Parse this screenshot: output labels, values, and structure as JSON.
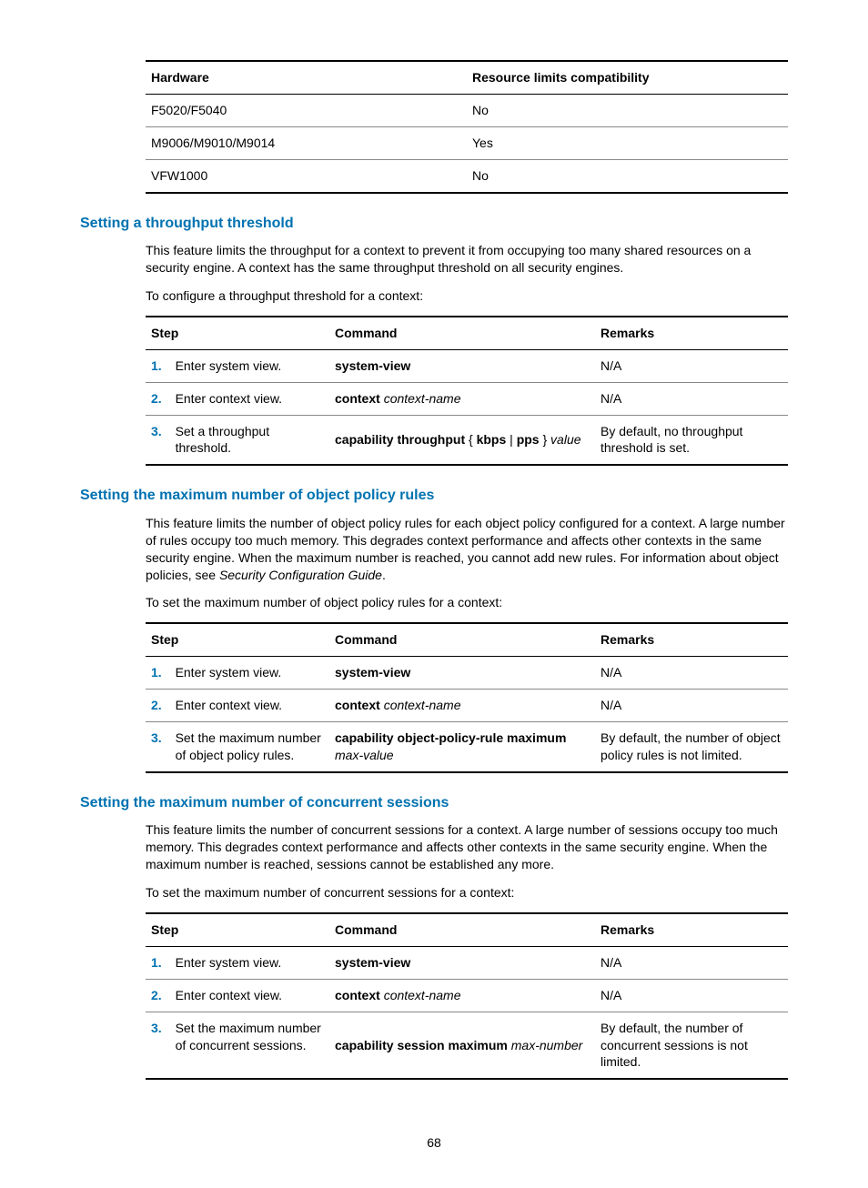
{
  "hwTable": {
    "headers": [
      "Hardware",
      "Resource limits compatibility"
    ],
    "rows": [
      [
        "F5020/F5040",
        "No"
      ],
      [
        "M9006/M9010/M9014",
        "Yes"
      ],
      [
        "VFW1000",
        "No"
      ]
    ]
  },
  "sections": [
    {
      "heading": "Setting a throughput threshold",
      "paras": [
        "This feature limits the throughput for a context to prevent it from occupying too many shared resources on a security engine. A context has the same throughput threshold on all security engines.",
        "To configure a throughput threshold for a context:"
      ],
      "table": {
        "headers": [
          "Step",
          "Command",
          "Remarks"
        ],
        "rows": [
          {
            "num": "1.",
            "desc": "Enter system view.",
            "cmd_parts": [
              {
                "b": "system-view"
              }
            ],
            "remarks": "N/A"
          },
          {
            "num": "2.",
            "desc": "Enter context view.",
            "cmd_parts": [
              {
                "b": "context "
              },
              {
                "i": "context-name"
              }
            ],
            "remarks": "N/A"
          },
          {
            "num": "3.",
            "desc": "Set a throughput threshold.",
            "cmd_parts": [
              {
                "b": "capability throughput"
              },
              {
                "t": " { "
              },
              {
                "b": "kbps"
              },
              {
                "t": " | "
              },
              {
                "b": "pps"
              },
              {
                "t": " } "
              },
              {
                "i": "value"
              }
            ],
            "remarks": "By default, no throughput threshold is set."
          }
        ]
      }
    },
    {
      "heading": "Setting the maximum number of object policy rules",
      "paras": [
        "This feature limits the number of object policy rules for each object policy configured for a context. A large number of rules occupy too much memory. This degrades context performance and affects other contexts in the same security engine. When the maximum number is reached, you cannot add new rules. For information about object policies, see |Security Configuration Guide|.",
        "To set the maximum number of object policy rules for a context:"
      ],
      "table": {
        "headers": [
          "Step",
          "Command",
          "Remarks"
        ],
        "rows": [
          {
            "num": "1.",
            "desc": "Enter system view.",
            "cmd_parts": [
              {
                "b": "system-view"
              }
            ],
            "remarks": "N/A"
          },
          {
            "num": "2.",
            "desc": "Enter context view.",
            "cmd_parts": [
              {
                "b": "context "
              },
              {
                "i": "context-name"
              }
            ],
            "remarks": "N/A"
          },
          {
            "num": "3.",
            "desc": "Set the maximum number of object policy rules.",
            "cmd_parts": [
              {
                "b": "capability object-policy-rule maximum "
              },
              {
                "i": "max-value"
              }
            ],
            "remarks": "By default, the number of object policy rules is not limited."
          }
        ]
      }
    },
    {
      "heading": "Setting the maximum number of concurrent sessions",
      "paras": [
        "This feature limits the number of concurrent sessions for a context. A large number of sessions occupy too much memory. This degrades context performance and affects other contexts in the same security engine. When the maximum number is reached, sessions cannot be established any more.",
        "To set the maximum number of concurrent sessions for a context:"
      ],
      "table": {
        "headers": [
          "Step",
          "Command",
          "Remarks"
        ],
        "rows": [
          {
            "num": "1.",
            "desc": "Enter system view.",
            "cmd_parts": [
              {
                "b": "system-view"
              }
            ],
            "remarks": "N/A"
          },
          {
            "num": "2.",
            "desc": "Enter context view.",
            "cmd_parts": [
              {
                "b": "context "
              },
              {
                "i": "context-name"
              }
            ],
            "remarks": "N/A"
          },
          {
            "num": "3.",
            "desc": "Set the maximum number of concurrent sessions.",
            "cmd_parts": [
              {
                "b": "capability session maximum "
              },
              {
                "i": "max-number"
              }
            ],
            "remarks": "By default, the number of concurrent sessions is not limited."
          }
        ]
      }
    }
  ],
  "pageNumber": "68"
}
